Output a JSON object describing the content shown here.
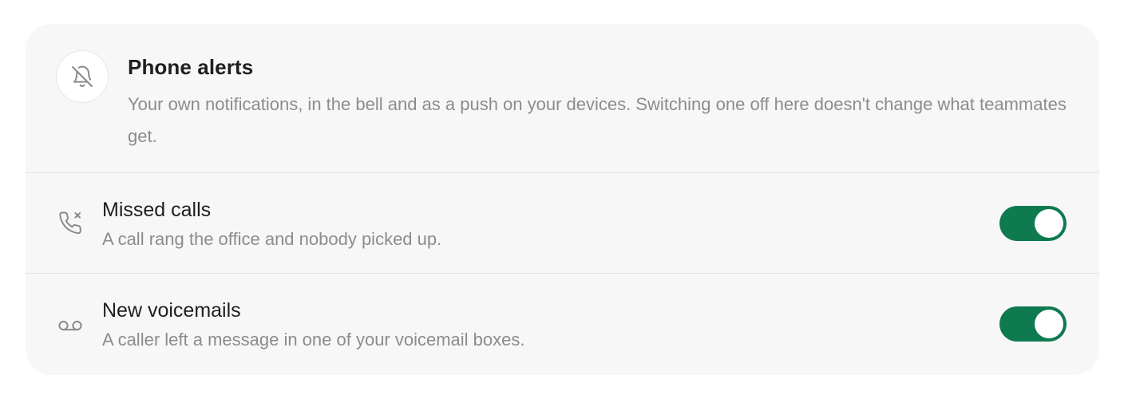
{
  "header": {
    "icon": "bell-off-icon",
    "title": "Phone alerts",
    "description": "Your own notifications, in the bell and as a push on your devices. Switching one off here doesn't change what teammates get."
  },
  "settings": [
    {
      "icon": "phone-missed-icon",
      "title": "Missed calls",
      "description": "A call rang the office and nobody picked up.",
      "enabled": true
    },
    {
      "icon": "voicemail-icon",
      "title": "New voicemails",
      "description": "A caller left a message in one of your voicemail boxes.",
      "enabled": true
    }
  ],
  "colors": {
    "card_background": "#f7f7f7",
    "toggle_on": "#0f7a4f",
    "title_text": "#1f1f1f",
    "muted_text": "#8c8c8c"
  }
}
